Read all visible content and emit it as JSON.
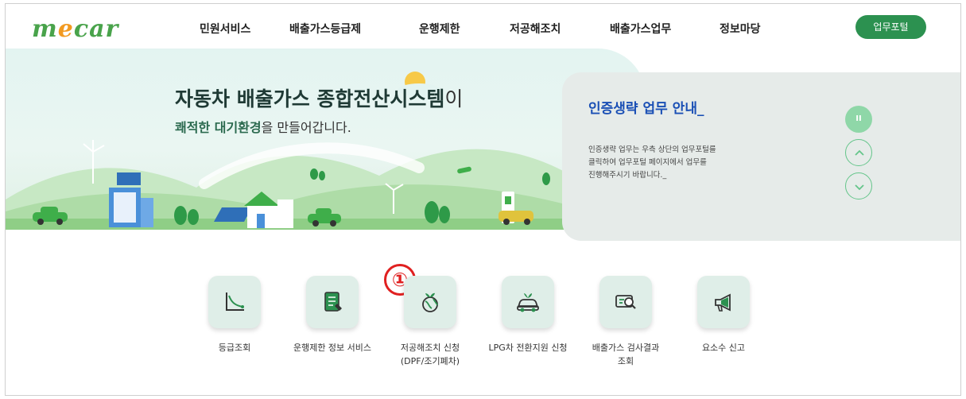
{
  "header": {
    "logo": {
      "part1": "m",
      "part2": "e",
      "part3": "car"
    },
    "nav": [
      "민원서비스",
      "배출가스등급제",
      "운행제한",
      "저공해조치",
      "배출가스업무",
      "정보마당"
    ],
    "portal_button": "업무포털"
  },
  "hero": {
    "title_main": "자동차 배출가스 종합전산시스템",
    "title_suffix": "이",
    "sub_bold": "쾌적한 대기환경",
    "sub_rest": "을 만들어갑니다."
  },
  "panel": {
    "title": "인증생략 업무 안내_",
    "text_lines": [
      "인증생략 업무는 우측 상단의 업무포털를",
      "클릭하여 업무포털 페이지에서 업무를",
      "진행해주시기 바랍니다._"
    ],
    "pause_label": "II"
  },
  "quick_menu": [
    {
      "icon": "graph-icon",
      "label1": "등급조회",
      "label2": ""
    },
    {
      "icon": "document-icon",
      "label1": "운행제한 정보 서비스",
      "label2": ""
    },
    {
      "icon": "earth-icon",
      "label1": "저공해조치 신청",
      "label2": "(DPF/조기폐차)"
    },
    {
      "icon": "car-leaf-icon",
      "label1": "LPG차 전환지원 신청",
      "label2": ""
    },
    {
      "icon": "inspection-icon",
      "label1": "배출가스 검사결과",
      "label2": "조회"
    },
    {
      "icon": "megaphone-icon",
      "label1": "요소수 신고",
      "label2": ""
    }
  ],
  "annotation": {
    "marker": "①"
  },
  "colors": {
    "brand_green": "#2c9150",
    "accent_blue": "#1a4fb5",
    "logo_orange": "#f29a21"
  }
}
